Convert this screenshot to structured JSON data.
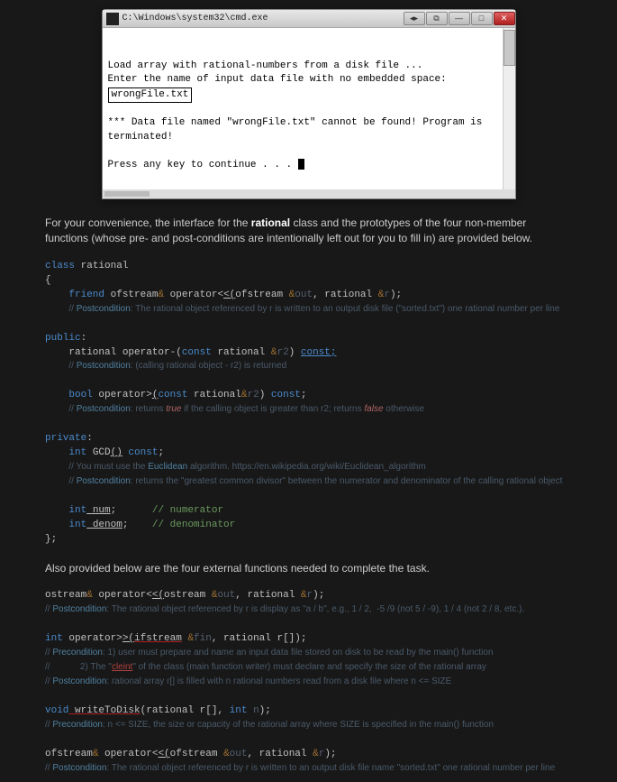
{
  "cmd": {
    "path": "C:\\Windows\\system32\\cmd.exe",
    "line1": "Load array with rational-numbers from a disk file ...",
    "line2a": "Enter the name of input data file with no embedded space:",
    "line2b": "wrongFile.txt",
    "line3": "*** Data file named \"wrongFile.txt\" cannot be found! Program is terminated!",
    "line4": "Press any key to continue . . . "
  },
  "para1a": "For your convenience, the interface for the ",
  "para1b": "rational",
  "para1c": " class and the prototypes of the four non-member functions (whose pre- and post-conditions are intentionally left out for you to fill in) are provided below.",
  "c": {
    "l1a": "class",
    "l1b": " rational",
    "l2": "{",
    "l3a": "friend",
    "l3b": " ofstream",
    "l3amp": "&",
    "l3c": " operator<",
    "l3c2": "<(",
    "l3d": "ofstream ",
    "l3e": "&",
    "l3f": "out",
    "l3g": ", rational ",
    "l3h": "&",
    "l3i": "r",
    "l3j": ");",
    "l4a": "// ",
    "l4b": "Postcondition",
    "l4c": ": The rational object referenced by r is written to an output disk file (\"sorted.txt\") one rational number per line",
    "l5a": "public",
    "l5b": ":",
    "l6a": "rational operator-(",
    "l6b": "const",
    "l6c": " rational ",
    "l6d": "&",
    "l6e": "r2",
    "l6f": ") ",
    "l6g": "const;",
    "l7a": "// ",
    "l7b": "Postcondition",
    "l7c": ": (calling rational object - r2) is returned",
    "l8a": "bool",
    "l8b": " operator>",
    "l8c": "(",
    "l8d": "const",
    "l8e": " rational",
    "l8f": "&",
    "l8g": "r2",
    "l8h": ") ",
    "l8i": "const",
    "l8j": ";",
    "l9a": "// ",
    "l9b": "Postcondition",
    "l9c": ": returns ",
    "l9d": "true",
    "l9e": " if the calling object is greater than r2; returns ",
    "l9f": "false",
    "l9g": " otherwise",
    "l10a": "private",
    "l10b": ":",
    "l11a": "int",
    "l11b": " GCD",
    "l11c": "()",
    "l11d": " const",
    "l11e": ";",
    "l12a": "// You must use the ",
    "l12b": "Euclidean",
    "l12c": " algorithm. https://en.wikipedia.org/wiki/Euclidean_algorithm",
    "l13a": "// ",
    "l13b": "Postcondition",
    "l13c": ": returns the \"greatest common divisor\" between the numerator and denominator of the calling rational object",
    "l14a": "int",
    "l14b": " num",
    "l14c": ";      ",
    "l14d": "// numerator",
    "l15a": "int",
    "l15b": " denom",
    "l15c": ";    ",
    "l15d": "// denominator",
    "l16": "};"
  },
  "para2": "Also provided below are the four external functions  needed to complete the task.",
  "e": {
    "l1a": "ostream",
    "l1b": "&",
    "l1c": " operator<",
    "l1c2": "<(",
    "l1d": "ostream ",
    "l1e": "&",
    "l1f": "out",
    "l1g": ", rational ",
    "l1h": "&",
    "l1i": "r",
    "l1j": ");",
    "l2a": "// ",
    "l2b": "Postcondition",
    "l2c": ": The rational object referenced by r is display as \"a / b\", e.g., 1 / 2,  -5 /9 (not 5 / -9), 1 / 4 (not 2 / 8, etc.).",
    "l3a": "int",
    "l3b": " operator>",
    "l3b2": ">(",
    "l3c": "ifstream",
    "l3d": " &",
    "l3e": "fin",
    "l3f": ", rational r[]",
    "l3g": ");",
    "l4a": "// ",
    "l4b": "Precondition",
    "l4c": ": 1) user must prepare and name an input data file stored on disk to be read by the main() function",
    "l5a": "//            2) The \"",
    "l5b": "cleint",
    "l5c": "\" of the class (main function writer) must declare and specify the size of the rational array",
    "l6a": "// ",
    "l6b": "Postcondition",
    "l6c": ": rational array r[] is filled with n rational numbers read from a disk file where n <= SIZE",
    "l7a": "void",
    "l7b": " writeToDisk",
    "l7c": "(",
    "l7d": "rational r[], ",
    "l7e": "int",
    "l7f": " n",
    "l7g": ");",
    "l8a": "// ",
    "l8b": "Precondition",
    "l8c": ": n <= SIZE, the size or capacity of the rational array where SIZE is specified in the main() function",
    "l9a": "ofstream",
    "l9b": "&",
    "l9c": " operator<",
    "l9c2": "<(",
    "l9d": "ofstream ",
    "l9e": "&",
    "l9f": "out",
    "l9g": ", rational ",
    "l9h": "&",
    "l9i": "r",
    "l9j": ");",
    "l10a": "// ",
    "l10b": "Postcondition",
    "l10c": ": The rational object referenced by r is written to an output disk file name \"sorted.txt\" one rational number per line"
  }
}
